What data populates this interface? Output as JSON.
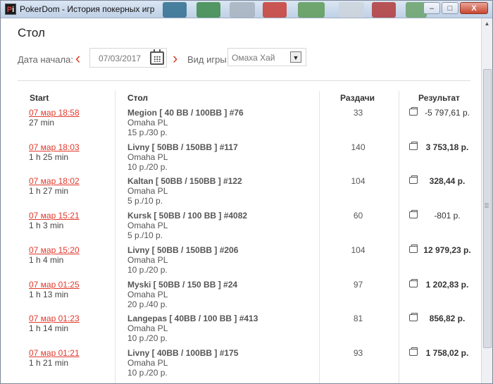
{
  "window": {
    "title": "PokerDom - История покерных игр",
    "app_icon_letters": [
      "P",
      "i"
    ],
    "buttons": {
      "minimize": "–",
      "maximize": "□",
      "close": "X"
    }
  },
  "page": {
    "title": "Стол"
  },
  "filters": {
    "start_date_label": "Дата начала:",
    "start_date_value": "07/03/2017",
    "game_type_label": "Вид игры:",
    "game_type_value": "Омаха Хай"
  },
  "table": {
    "columns": {
      "start": "Start",
      "table": "Стол",
      "hands": "Раздачи",
      "result": "Результат"
    },
    "rows": [
      {
        "start": "07 мар 18:58",
        "duration": "27 min",
        "name": "Megion [ 40 BB / 100BB ] #76",
        "game": "Omaha PL",
        "stakes": "15 р./30 р.",
        "hands": "33",
        "result": "-5 797,61 р."
      },
      {
        "start": "07 мар 18:03",
        "duration": "1 h 25 min",
        "name": "Livny [ 50BB / 150BB ] #117",
        "game": "Omaha PL",
        "stakes": "10 р./20 р.",
        "hands": "140",
        "result": "3 753,18 р."
      },
      {
        "start": "07 мар 18:02",
        "duration": "1 h 27 min",
        "name": "Kaltan [ 50BB / 150BB ] #122",
        "game": "Omaha PL",
        "stakes": "5 р./10 р.",
        "hands": "104",
        "result": "328,44 р."
      },
      {
        "start": "07 мар 15:21",
        "duration": "1 h 3 min",
        "name": "Kursk [ 50BB / 100 BB ] #4082",
        "game": "Omaha PL",
        "stakes": "5 р./10 р.",
        "hands": "60",
        "result": "-801 р."
      },
      {
        "start": "07 мар 15:20",
        "duration": "1 h 4 min",
        "name": "Livny [ 50BB / 150BB ] #206",
        "game": "Omaha PL",
        "stakes": "10 р./20 р.",
        "hands": "104",
        "result": "12 979,23 р."
      },
      {
        "start": "07 мар 01:25",
        "duration": "1 h 13 min",
        "name": "Myski [ 50BB / 150 BB ] #24",
        "game": "Omaha PL",
        "stakes": "20 р./40 р.",
        "hands": "97",
        "result": "1 202,83 р."
      },
      {
        "start": "07 мар 01:23",
        "duration": "1 h 14 min",
        "name": "Langepas [ 40BB / 100 BB ] #413",
        "game": "Omaha PL",
        "stakes": "10 р./20 р.",
        "hands": "81",
        "result": "856,82 р."
      },
      {
        "start": "07 мар 01:21",
        "duration": "1 h 21 min",
        "name": "Livny [ 40BB / 100BB ] #175",
        "game": "Omaha PL",
        "stakes": "10 р./20 р.",
        "hands": "93",
        "result": "1 758,02 р."
      }
    ]
  },
  "colors": {
    "accent": "#e2392c",
    "header_text": "#333333",
    "muted_text": "#555555"
  }
}
